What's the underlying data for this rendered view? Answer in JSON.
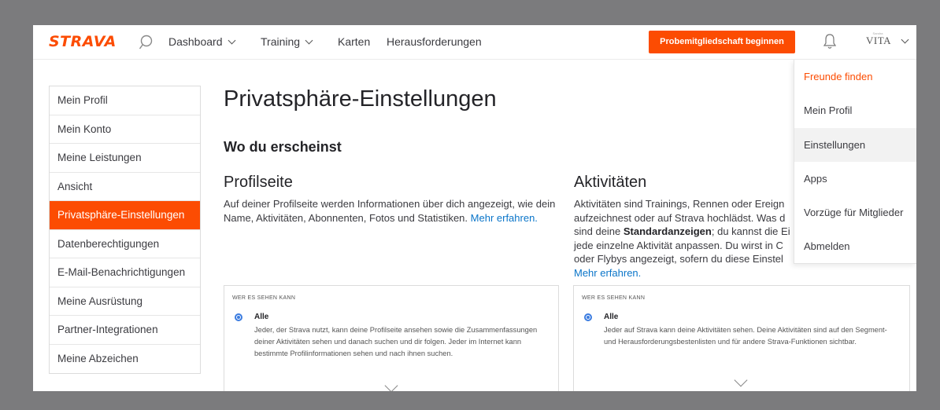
{
  "header": {
    "logo": "STRAVA",
    "nav": [
      {
        "label": "Dashboard",
        "has_dropdown": true
      },
      {
        "label": "Training",
        "has_dropdown": true
      },
      {
        "label": "Karten",
        "has_dropdown": false
      },
      {
        "label": "Herausforderungen",
        "has_dropdown": false
      }
    ],
    "trial_button": "Probemitgliedschaft beginnen",
    "avatar": {
      "small_text": "Sandra",
      "big_text": "VITA"
    }
  },
  "sidebar": {
    "items": [
      {
        "label": "Mein Profil",
        "active": false
      },
      {
        "label": "Mein Konto",
        "active": false
      },
      {
        "label": "Meine Leistungen",
        "active": false
      },
      {
        "label": "Ansicht",
        "active": false
      },
      {
        "label": "Privatsphäre-Einstellungen",
        "active": true
      },
      {
        "label": "Datenberechtigungen",
        "active": false
      },
      {
        "label": "E-Mail-Benachrichtigungen",
        "active": false
      },
      {
        "label": "Meine Ausrüstung",
        "active": false
      },
      {
        "label": "Partner-Integrationen",
        "active": false
      },
      {
        "label": "Meine Abzeichen",
        "active": false
      }
    ]
  },
  "main": {
    "title": "Privatsphäre-Einstellungen",
    "subtitle": "Wo du erscheinst",
    "profile": {
      "title": "Profilseite",
      "text": "Auf deiner Profilseite werden Informationen über dich angezeigt, wie dein Name, Aktivitäten, Abonnenten, Fotos und Statistiken.",
      "link": "Mehr erfahren.",
      "card": {
        "heading": "WER ES SEHEN KANN",
        "option": "Alle",
        "description": "Jeder, der Strava nutzt, kann deine Profilseite ansehen sowie die Zusammenfassungen deiner Aktivitäten sehen und danach suchen und dir folgen. Jeder im Internet kann bestimmte Profilinformationen sehen und nach ihnen suchen."
      }
    },
    "activities": {
      "title": "Aktivitäten",
      "text_1": "Aktivitäten sind Trainings, Rennen oder Ereign",
      "text_2": "aufzeichnest oder auf Strava hochlädst. Was d",
      "text_3a": "sind deine ",
      "text_3b": "Standardanzeigen",
      "text_3c": "; du kannst die Ei",
      "text_4": "jede einzelne Aktivität anpassen. Du wirst in C",
      "text_5": "oder Flybys angezeigt, sofern du diese Einstel",
      "link": "Mehr erfahren.",
      "card": {
        "heading": "WER ES SEHEN KANN",
        "option": "Alle",
        "description": "Jeder auf Strava kann deine Aktivitäten sehen. Deine Aktivitäten sind auf den Segment- und Herausforderungsbestenlisten und für andere Strava-Funktionen sichtbar."
      }
    }
  },
  "dropdown": {
    "items": [
      {
        "label": "Freunde finden",
        "accent": true
      },
      {
        "label": "Mein Profil"
      },
      {
        "label": "Einstellungen",
        "highlighted": true
      },
      {
        "label": "Apps"
      },
      {
        "label": "Vorzüge für Mitglieder"
      },
      {
        "label": "Abmelden"
      }
    ]
  },
  "colors": {
    "brand": "#fc4c02",
    "link": "#0a75c9",
    "radio": "#3b7ce0",
    "backdrop": "#7b7b7d"
  },
  "icons": [
    "search-icon",
    "chevron-down-icon",
    "bell-icon",
    "avatar"
  ]
}
